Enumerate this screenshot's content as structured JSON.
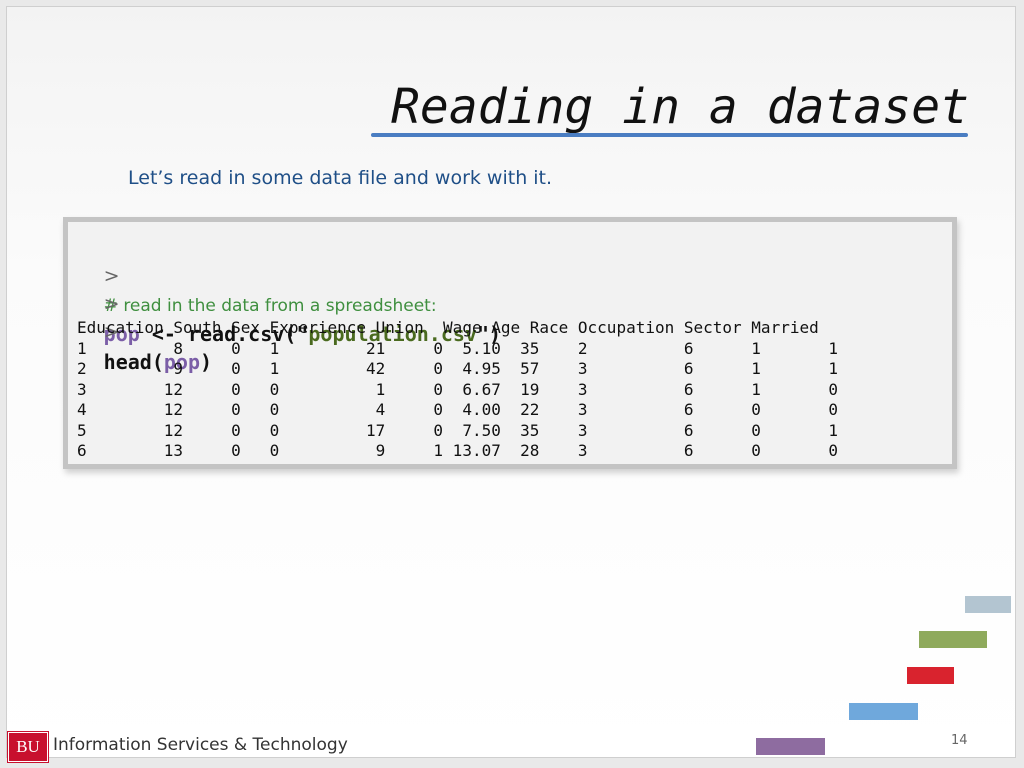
{
  "slide": {
    "title": "Reading in a dataset",
    "subtitle": "Let’s read in some data file and work with it.",
    "code": {
      "prompt": ">",
      "comment": "# read in the data from a spreadsheet:",
      "line2": {
        "var": "pop",
        "op": " <- read.csv(\"",
        "str": "population.csv",
        "close": "\")"
      },
      "line3": {
        "fn": "head(",
        "var": "pop",
        "close": ")"
      },
      "output_header": "Education South Sex Experience Union  Wage Age Race Occupation Sector Married",
      "output_rows": [
        "1         8     0   1         21     0  5.10  35    2          6      1       1",
        "2         9     0   1         42     0  4.95  57    3          6      1       1",
        "3        12     0   0          1     0  6.67  19    3          6      1       0",
        "4        12     0   0          4     0  4.00  22    3          6      0       0",
        "5        12     0   0         17     0  7.50  35    3          6      0       1",
        "6        13     0   0          9     1 13.07  28    3          6      0       0"
      ]
    },
    "page_number": "14"
  },
  "footer": {
    "logo_text": "BU",
    "org": "Information Services & Technology"
  },
  "decor": {
    "bar_colors": [
      "#b3c5d1",
      "#8faa5c",
      "#d9232e",
      "#6fa8dc",
      "#8e6ca0"
    ]
  }
}
